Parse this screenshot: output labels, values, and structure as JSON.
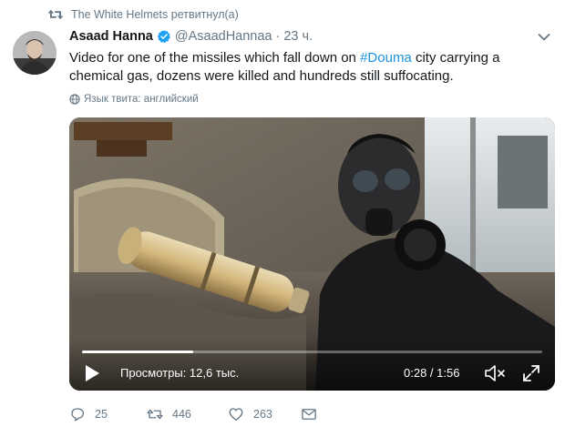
{
  "retweet_context": {
    "text": "The White Helmets ретвитнул(а)",
    "icon": "retweet-icon"
  },
  "author": {
    "fullname": "Asaad Hanna",
    "handle": "@AsaadHannaa",
    "separator": "·",
    "time": "23 ч.",
    "verified": true
  },
  "tweet": {
    "text_before": "Video for one of the missiles which fall down on ",
    "hashtag": "#Douma",
    "text_after": " city carrying a chemical gas, dozens were killed and hundreds still suffocating.",
    "translate_label": "Язык твита: английский"
  },
  "video": {
    "views_label": "Просмотры: 12,6 тыс.",
    "time_label": "0:28 / 1:56",
    "progress": 0.241
  },
  "actions": {
    "reply_count": "25",
    "retweet_count": "446",
    "like_count": "263"
  },
  "colors": {
    "link": "#1b95e0",
    "secondary_text": "#657786",
    "verified": "#1da1f2"
  }
}
